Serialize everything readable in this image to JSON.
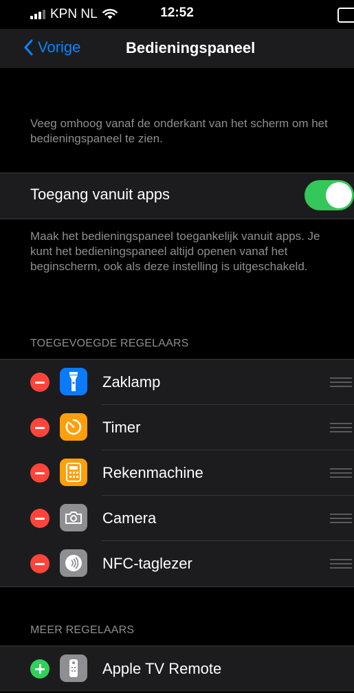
{
  "status_bar": {
    "carrier": "KPN NL",
    "time": "12:52"
  },
  "nav": {
    "back_label": "Vorige",
    "title": "Bedieningspaneel"
  },
  "intro_text": "Veeg omhoog vanaf de onderkant van het scherm om het bedieningspaneel te zien.",
  "access": {
    "label": "Toegang vanuit apps",
    "enabled": true,
    "toggle_color": "#34c759"
  },
  "access_description": "Maak het bedieningspaneel toegankelijk vanuit apps. Je kunt het bedieningspaneel altijd openen vanaf het beginscherm, ook als deze instelling is uitgeschakeld.",
  "included": {
    "header": "TOEGEVOEGDE REGELAARS",
    "items": [
      {
        "label": "Zaklamp",
        "icon": "flashlight-icon",
        "color": "#0a7aff"
      },
      {
        "label": "Timer",
        "icon": "timer-icon",
        "color": "#ff9f0a"
      },
      {
        "label": "Rekenmachine",
        "icon": "calculator-icon",
        "color": "#ff9f0a"
      },
      {
        "label": "Camera",
        "icon": "camera-icon",
        "color": "#8e8e93"
      },
      {
        "label": "NFC-taglezer",
        "icon": "nfc-icon",
        "color": "#8e8e93"
      }
    ]
  },
  "more": {
    "header": "MEER REGELAARS",
    "items": [
      {
        "label": "Apple TV Remote",
        "icon": "tv-remote-icon",
        "color": "#8e8e93"
      }
    ]
  },
  "colors": {
    "accent": "#0a84ff",
    "remove": "#ff453a",
    "add": "#30d158"
  }
}
